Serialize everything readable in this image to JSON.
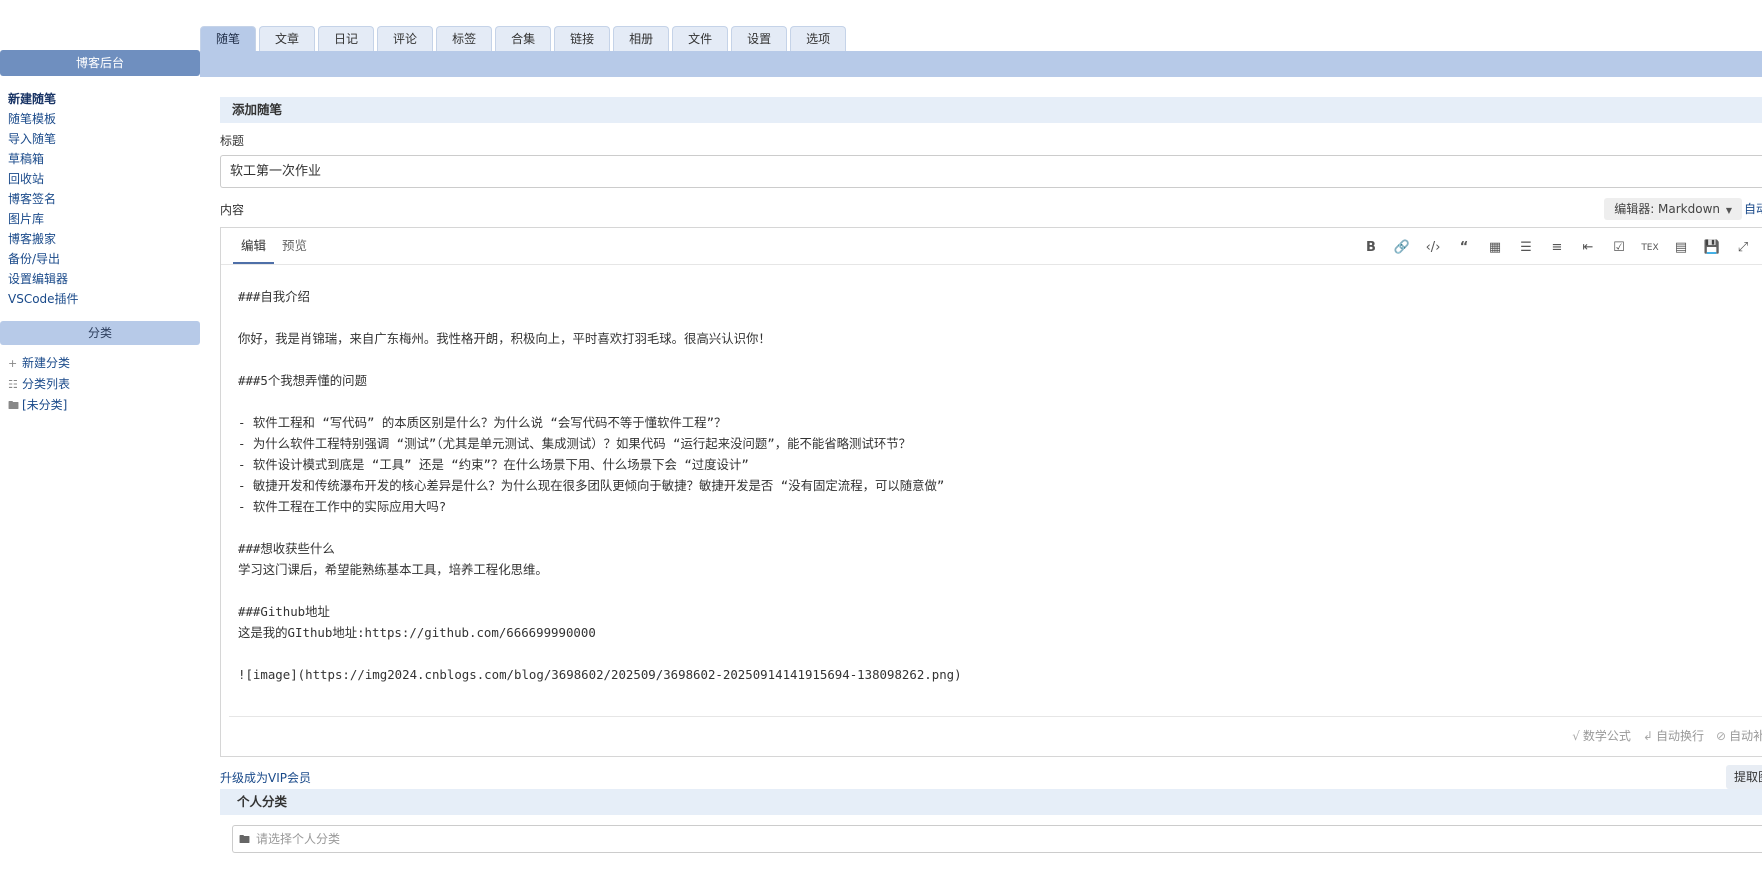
{
  "top_tabs": [
    "随笔",
    "文章",
    "日记",
    "评论",
    "标签",
    "合集",
    "链接",
    "相册",
    "文件",
    "设置",
    "选项"
  ],
  "active_tab": "随笔",
  "sidebar": {
    "header": "博客后台",
    "items": [
      "新建随笔",
      "随笔模板",
      "导入随笔",
      "草稿箱",
      "回收站",
      "博客签名",
      "图片库",
      "博客搬家",
      "备份/导出",
      "设置编辑器",
      "VSCode插件"
    ],
    "category_header": "分类",
    "category_items": [
      {
        "icon": "plus-icon",
        "label": "新建分类"
      },
      {
        "icon": "list-icon",
        "label": "分类列表"
      },
      {
        "icon": "folder-icon",
        "label": "[未分类]"
      }
    ]
  },
  "main": {
    "section_title": "添加随笔",
    "title_label": "标题",
    "title_value": "软工第一次作业",
    "content_label": "内容",
    "editor_select": "编辑器: Markdown",
    "autosave_label": "自动",
    "editor_tabs": [
      "编辑",
      "预览"
    ],
    "toolbar_icons": [
      "bold-icon",
      "link-icon",
      "code-icon",
      "quote-icon",
      "table-icon",
      "unordered-list-icon",
      "ordered-list-icon",
      "indent-icon",
      "checkbox-icon",
      "tex-icon",
      "toc-icon",
      "save-icon",
      "fullscreen-icon"
    ],
    "toolbar_glyphs": {
      "tex": "TEX"
    },
    "content_lines": [
      "###自我介绍",
      "",
      "你好，我是肖锦瑞，来自广东梅州。我性格开朗，积极向上，平时喜欢打羽毛球。很高兴认识你！",
      "",
      "###5个我想弄懂的问题",
      "",
      "- 软件工程和 “写代码” 的本质区别是什么？为什么说 “会写代码不等于懂软件工程”？",
      "- 为什么软件工程特别强调 “测试”（尤其是单元测试、集成测试）？如果代码 “运行起来没问题”，能不能省略测试环节？",
      "- 软件设计模式到底是 “工具” 还是 “约束”？在什么场景下用、什么场景下会 “过度设计”",
      "- 敏捷开发和传统瀑布开发的核心差异是什么？为什么现在很多团队更倾向于敏捷？敏捷开发是否 “没有固定流程，可以随意做”",
      "- 软件工程在工作中的实际应用大吗?",
      "",
      "###想收获些什么",
      "学习这门课后，希望能熟练基本工具，培养工程化思维。",
      "",
      "###Github地址",
      "这是我的GIthub地址:https://github.com/666699990000",
      "",
      "![image](https://img2024.cnblogs.com/blog/3698602/202509/3698602-20250914141915694-138098262.png)"
    ],
    "status_items": [
      {
        "icon": "sqrt-icon",
        "label": "数学公式"
      },
      {
        "icon": "wrap-icon",
        "label": "自动换行"
      },
      {
        "icon": "sync-off-icon",
        "label": "自动补"
      }
    ],
    "vip_link": "升级成为VIP会员",
    "extract_button": "提取图",
    "category_section_title": "个人分类",
    "category_placeholder": "请选择个人分类"
  }
}
